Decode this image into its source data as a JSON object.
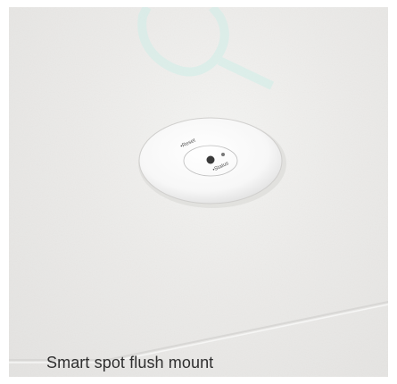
{
  "caption": "Smart spot flush mount",
  "sensor_labels": {
    "top": "•Reset",
    "bottom": "•Status"
  },
  "icons": {
    "watermark": "watermark-logo",
    "device": "ceiling-sensor-device"
  },
  "colors": {
    "ceiling": "#ebeae8",
    "watermark": "#cfeee8",
    "caption_text": "#2f2f2f"
  }
}
